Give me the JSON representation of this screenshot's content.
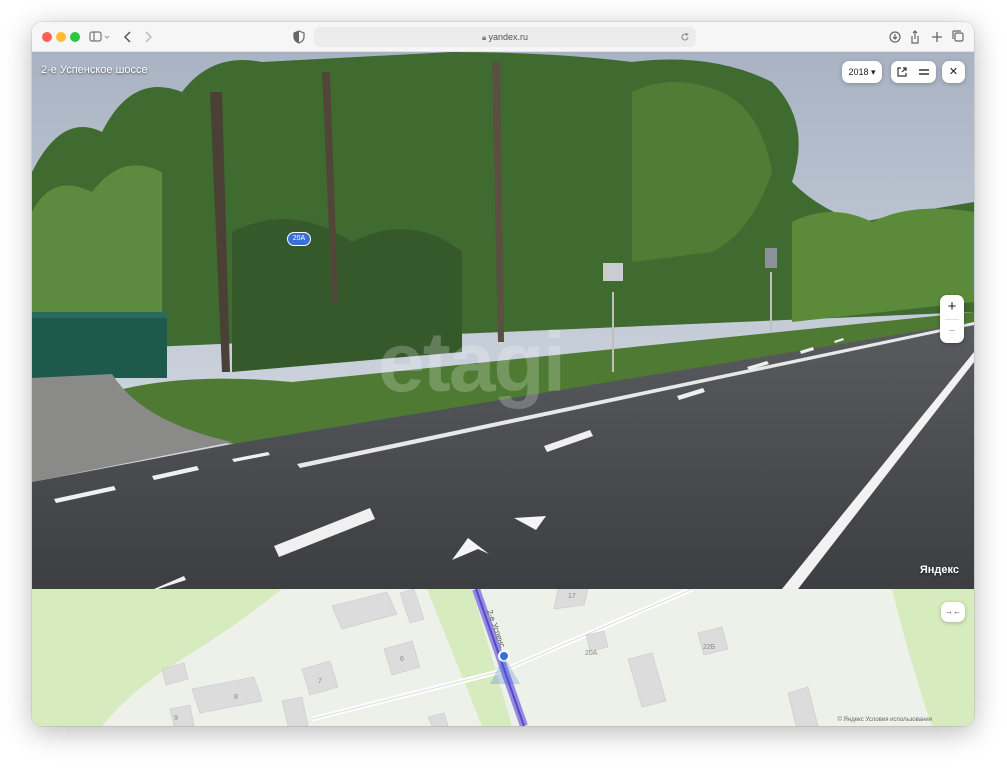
{
  "browser": {
    "url": "yandex.ru",
    "traffic_lights": [
      "#fe5f57",
      "#febc2e",
      "#28c840"
    ]
  },
  "panorama": {
    "location_title": "2-е Успенское шоссе",
    "year_selector": "2018 ▾",
    "house_badge": "20А",
    "watermark": "etagi",
    "logo": "Яндекс",
    "zoom_in": "+",
    "zoom_out": "−",
    "close": "✕"
  },
  "map": {
    "street_label": "2-е Успенс",
    "house_numbers": [
      "17",
      "6",
      "7",
      "8",
      "9",
      "20А",
      "22Б"
    ],
    "collapse_icon": "→←",
    "copyright": "© Яндекс",
    "terms": "Условия использования"
  },
  "colors": {
    "sky": "#c4ccd8",
    "foliage": "#3f6a30",
    "road": "#4a4b4f",
    "map_land": "#eef0ea",
    "map_green": "#d7ecbe",
    "map_road_highlight": "#8a7fe0",
    "fence": "#1e5a4c"
  }
}
